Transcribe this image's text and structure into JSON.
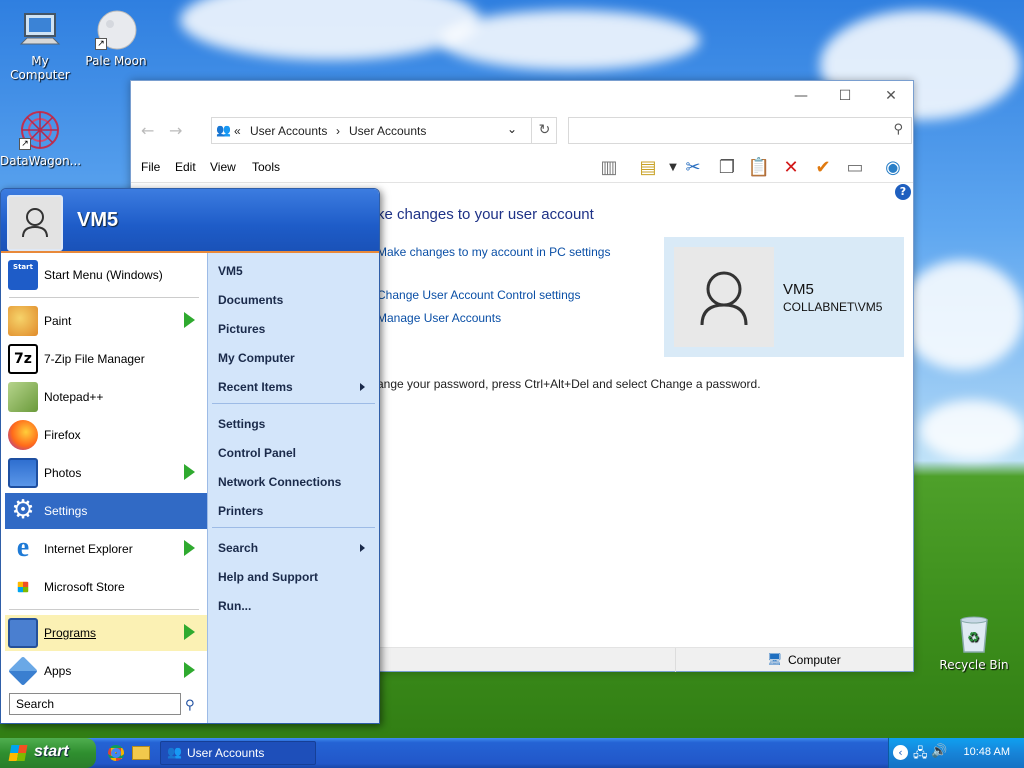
{
  "desktop": {
    "icons": [
      {
        "label": "My Computer"
      },
      {
        "label": "Pale Moon"
      },
      {
        "label": "DataWagon..."
      },
      {
        "label": "Recycle Bin"
      }
    ]
  },
  "window": {
    "address": {
      "sep": "«",
      "crumb1": "User Accounts",
      "crumb2": "User Accounts"
    },
    "menu": [
      "File",
      "Edit",
      "View",
      "Tools"
    ],
    "heading": "ke changes to your user account",
    "links": [
      "Make changes to my account in PC settings",
      "Change User Account Control settings",
      "Manage User Accounts"
    ],
    "note": "ange your password, press Ctrl+Alt+Del and select Change a password.",
    "user": {
      "name": "VM5",
      "account": "COLLABNET\\VM5"
    },
    "status": {
      "location": "Computer"
    }
  },
  "startmenu": {
    "user": "VM5",
    "left_items": [
      {
        "label": "Start Menu (Windows)"
      },
      {
        "label": "Paint"
      },
      {
        "label": "7-Zip File Manager"
      },
      {
        "label": "Notepad++"
      },
      {
        "label": "Firefox"
      },
      {
        "label": "Photos"
      },
      {
        "label": "Settings"
      },
      {
        "label": "Internet Explorer"
      },
      {
        "label": "Microsoft Store"
      },
      {
        "label": "Programs"
      },
      {
        "label": "Apps"
      }
    ],
    "search_placeholder": "Search",
    "right_items": [
      {
        "label": "VM5"
      },
      {
        "label": "Documents"
      },
      {
        "label": "Pictures"
      },
      {
        "label": "My Computer"
      },
      {
        "label": "Recent Items"
      },
      {
        "label": "Settings"
      },
      {
        "label": "Control Panel"
      },
      {
        "label": "Network Connections"
      },
      {
        "label": "Printers"
      },
      {
        "label": "Search"
      },
      {
        "label": "Help and Support"
      },
      {
        "label": "Run..."
      }
    ]
  },
  "taskbar": {
    "start": "start",
    "window_button": "User Accounts",
    "clock": "10:48 AM"
  },
  "colors": {
    "accent": "#316ac5",
    "taskbar": "#2257c9",
    "start": "#2f8f2f"
  }
}
